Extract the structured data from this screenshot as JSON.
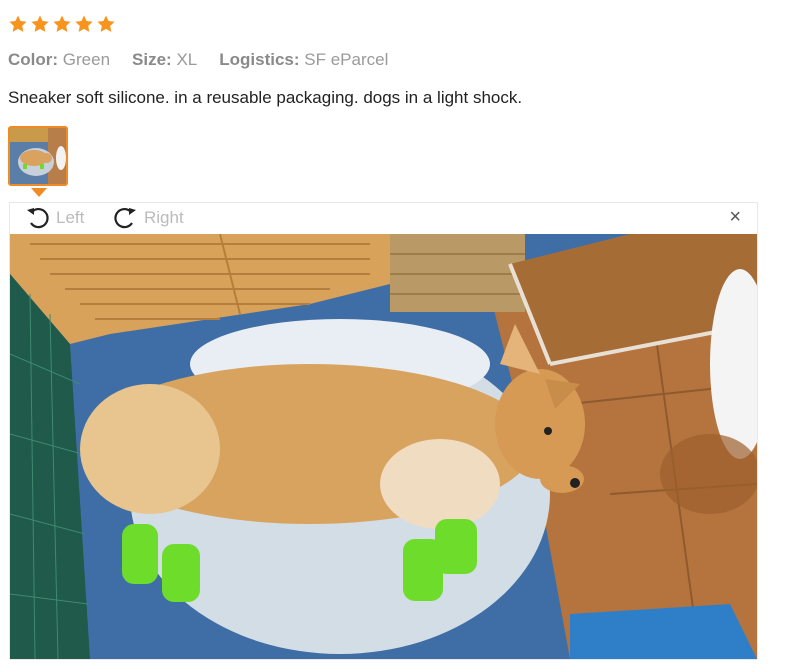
{
  "rating": {
    "stars": 5,
    "max": 5,
    "color": "#f7941d"
  },
  "attributes": [
    {
      "key": "Color:",
      "value": "Green"
    },
    {
      "key": "Size:",
      "value": "XL"
    },
    {
      "key": "Logistics:",
      "value": "SF eParcel"
    }
  ],
  "review": {
    "text": "Sneaker soft silicone. in a reusable packaging. dogs in a light shock."
  },
  "viewer": {
    "rotate_left_label": "Left",
    "rotate_right_label": "Right",
    "close_symbol": "×",
    "accent_color": "#f08a24"
  },
  "icons": {
    "star": "star-icon",
    "rotate_left": "rotate-left-icon",
    "rotate_right": "rotate-right-icon",
    "close": "close-icon"
  }
}
